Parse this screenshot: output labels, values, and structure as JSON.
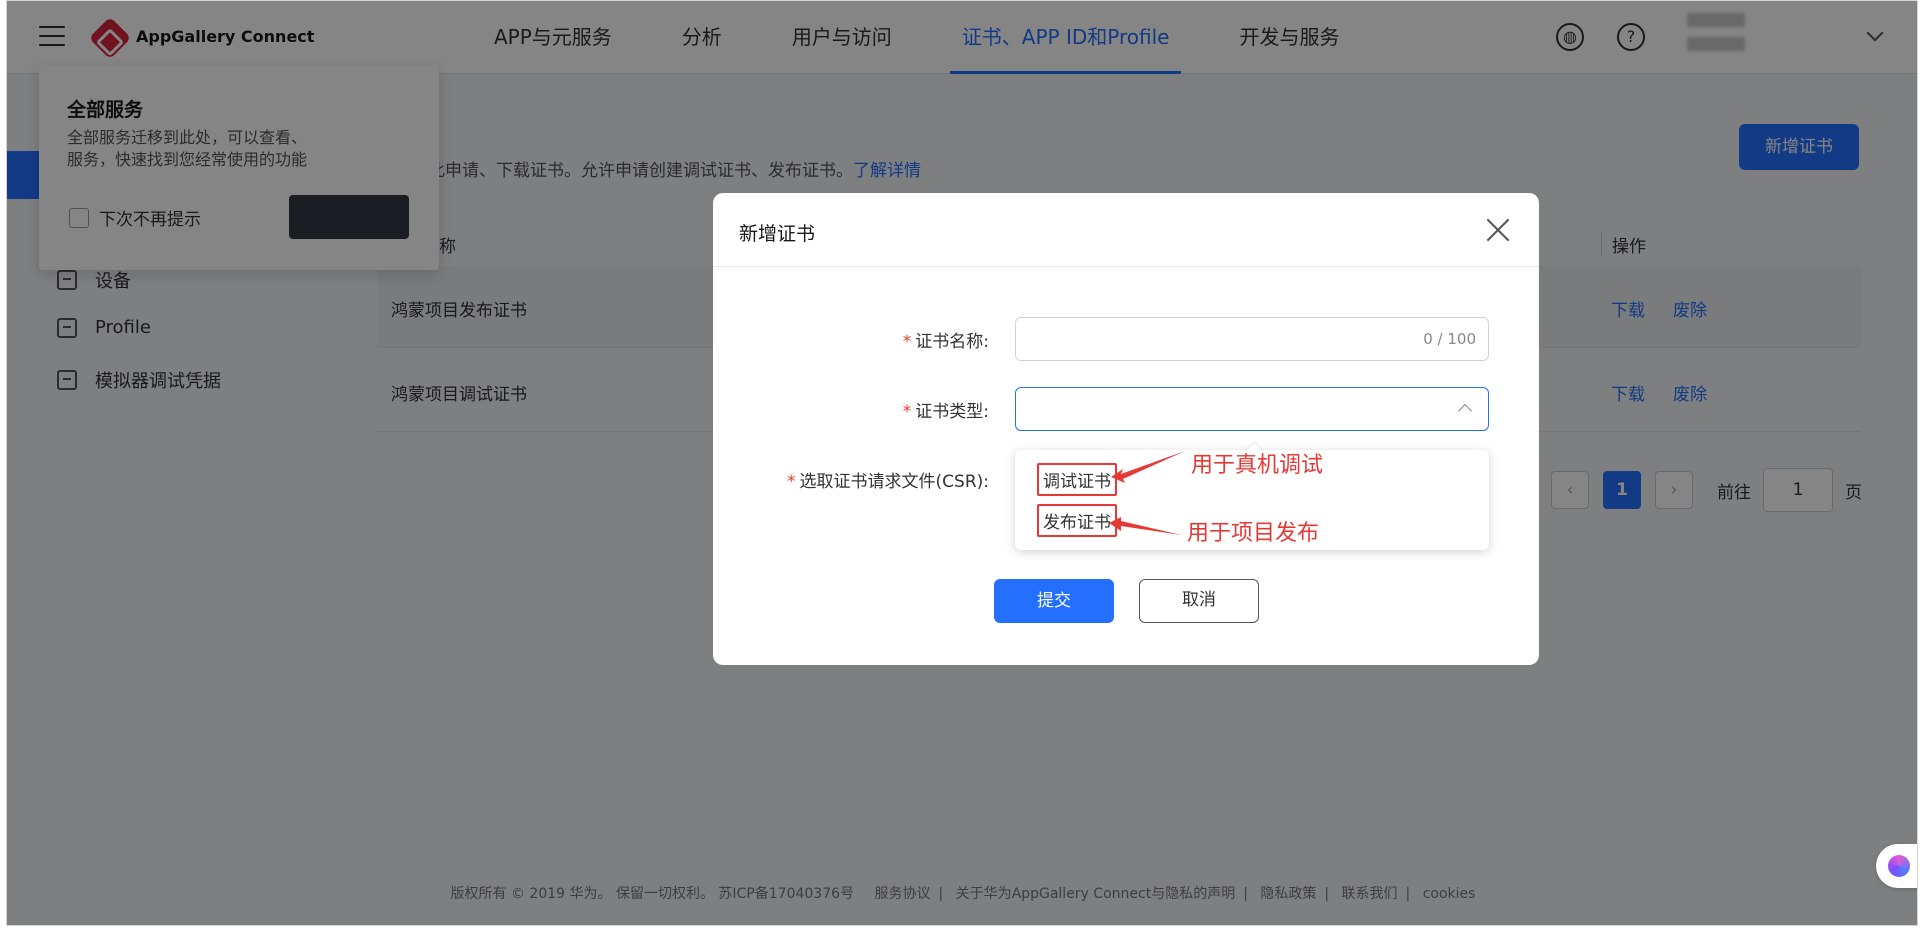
{
  "topbar": {
    "brand": "AppGallery Connect",
    "nav": [
      "APP与元服务",
      "分析",
      "用户与访问",
      "证书、APP ID和Profile",
      "开发与服务"
    ],
    "active_nav": "证书、APP ID和Profile",
    "help_icon": "?"
  },
  "sidebar": {
    "items": [
      "设备",
      "Profile",
      "模拟器调试凭据"
    ]
  },
  "service_popup": {
    "title": "全部服务",
    "desc_line1": "全部服务迁移到此处，可以查看、",
    "desc_line2": "服务，快速找到您经常使用的功能",
    "checkbox_label": "下次不再提示"
  },
  "page": {
    "title": "证书",
    "desc": "您可在此申请、下载证书。允许申请创建调试证书、发布证书。",
    "learn_more": "了解详情",
    "add_button": "新增证书"
  },
  "table": {
    "col_name": "证书名称",
    "col_ops": "操作",
    "rows": [
      {
        "name": "鸿蒙项目发布证书",
        "download": "下载",
        "revoke": "废除"
      },
      {
        "name": "鸿蒙项目调试证书",
        "download": "下载",
        "revoke": "废除"
      }
    ]
  },
  "pager": {
    "current": "1",
    "goto_label": "前往",
    "goto_value": "1",
    "page_suffix": "页"
  },
  "footer": {
    "copyright": "版权所有 © 2019 华为。 保留一切权利。 苏ICP备17040376号",
    "links": [
      "服务协议",
      "关于华为AppGallery Connect与隐私的声明",
      "隐私政策",
      "联系我们",
      "cookies"
    ]
  },
  "dialog": {
    "title": "新增证书",
    "field_name_label": "证书名称:",
    "field_name_count": "0 / 100",
    "field_type_label": "证书类型:",
    "field_csr_label": "选取证书请求文件(CSR):",
    "options": [
      "调试证书",
      "发布证书"
    ],
    "annotations": [
      "用于真机调试",
      "用于项目发布"
    ],
    "submit": "提交",
    "cancel": "取消"
  }
}
